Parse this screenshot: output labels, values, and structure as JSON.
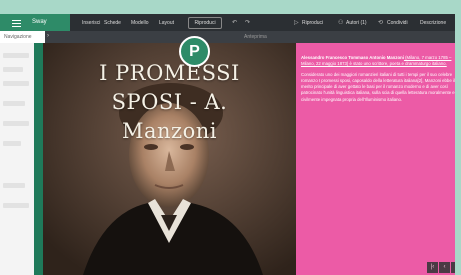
{
  "toolbar": {
    "brand": "Sway",
    "menu": [
      {
        "label": "Inserisci"
      },
      {
        "label": "Schede"
      },
      {
        "label": "Modello"
      },
      {
        "label": "Layout"
      }
    ],
    "play_label": "Riproduci",
    "right_items": [
      {
        "label": "Riproduci"
      },
      {
        "label": "Autori (1)"
      },
      {
        "label": "Condividi"
      },
      {
        "label": "Descrizione"
      }
    ]
  },
  "subbar": {
    "left_label": "Navigazione",
    "title": "Anteprima"
  },
  "badge": {
    "letter": "P"
  },
  "slide": {
    "title_line1": "I PROMESSI",
    "title_line2": "SPOSI - A.",
    "title_line3": "Manzoni"
  },
  "pink_panel": {
    "bio_bold": "Alessandro Francesco Tommaso Antonio Manzoni",
    "bio_rest": " (Milano, 7 marzo 1785 – Milano, 22 maggio 1873) è stato uno scrittore, poeta e drammaturgo italiano.",
    "para2": "Considerato uno dei maggiori romanzieri italiani di tutti i tempi per il suo celebre romanzo I promessi sposi, caposaldo della letteratura italiana[2], Manzoni ebbe il merito principale di aver gettato le basi per il romanzo moderno e di aver così patrocinato l'unità linguistica italiana, sulla scia di quella letteratura moralmente e civilmente impegnata propria dell'Illuminismo italiano."
  },
  "nav": {
    "prev": "‹",
    "next": "›",
    "first": "|‹"
  },
  "colors": {
    "toolbar": "#2b2f33",
    "brand_green": "#2e8b68",
    "pink": "#ec5ba6",
    "page_bg": "#a8d8c8"
  }
}
